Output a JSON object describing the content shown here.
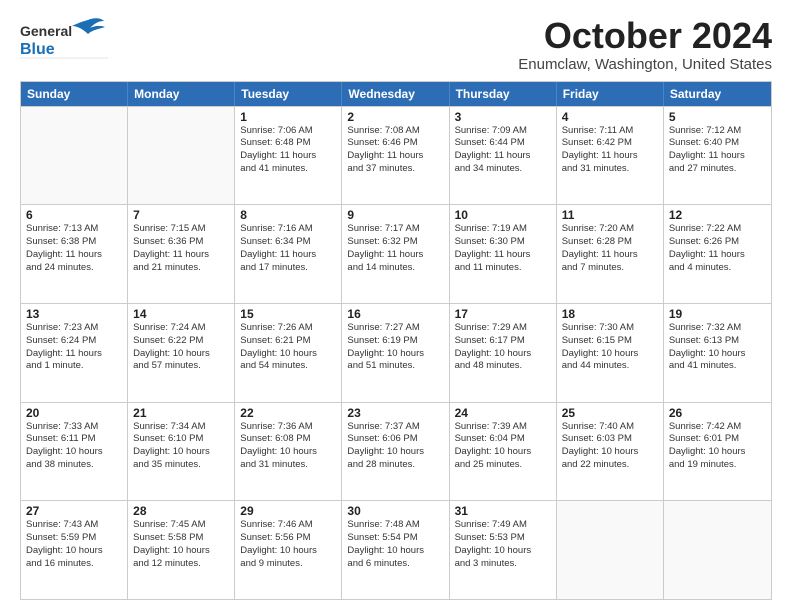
{
  "header": {
    "logo_general": "General",
    "logo_blue": "Blue",
    "title": "October 2024",
    "subtitle": "Enumclaw, Washington, United States"
  },
  "weekdays": [
    "Sunday",
    "Monday",
    "Tuesday",
    "Wednesday",
    "Thursday",
    "Friday",
    "Saturday"
  ],
  "weeks": [
    [
      {
        "day": "",
        "info": ""
      },
      {
        "day": "",
        "info": ""
      },
      {
        "day": "1",
        "info": "Sunrise: 7:06 AM\nSunset: 6:48 PM\nDaylight: 11 hours\nand 41 minutes."
      },
      {
        "day": "2",
        "info": "Sunrise: 7:08 AM\nSunset: 6:46 PM\nDaylight: 11 hours\nand 37 minutes."
      },
      {
        "day": "3",
        "info": "Sunrise: 7:09 AM\nSunset: 6:44 PM\nDaylight: 11 hours\nand 34 minutes."
      },
      {
        "day": "4",
        "info": "Sunrise: 7:11 AM\nSunset: 6:42 PM\nDaylight: 11 hours\nand 31 minutes."
      },
      {
        "day": "5",
        "info": "Sunrise: 7:12 AM\nSunset: 6:40 PM\nDaylight: 11 hours\nand 27 minutes."
      }
    ],
    [
      {
        "day": "6",
        "info": "Sunrise: 7:13 AM\nSunset: 6:38 PM\nDaylight: 11 hours\nand 24 minutes."
      },
      {
        "day": "7",
        "info": "Sunrise: 7:15 AM\nSunset: 6:36 PM\nDaylight: 11 hours\nand 21 minutes."
      },
      {
        "day": "8",
        "info": "Sunrise: 7:16 AM\nSunset: 6:34 PM\nDaylight: 11 hours\nand 17 minutes."
      },
      {
        "day": "9",
        "info": "Sunrise: 7:17 AM\nSunset: 6:32 PM\nDaylight: 11 hours\nand 14 minutes."
      },
      {
        "day": "10",
        "info": "Sunrise: 7:19 AM\nSunset: 6:30 PM\nDaylight: 11 hours\nand 11 minutes."
      },
      {
        "day": "11",
        "info": "Sunrise: 7:20 AM\nSunset: 6:28 PM\nDaylight: 11 hours\nand 7 minutes."
      },
      {
        "day": "12",
        "info": "Sunrise: 7:22 AM\nSunset: 6:26 PM\nDaylight: 11 hours\nand 4 minutes."
      }
    ],
    [
      {
        "day": "13",
        "info": "Sunrise: 7:23 AM\nSunset: 6:24 PM\nDaylight: 11 hours\nand 1 minute."
      },
      {
        "day": "14",
        "info": "Sunrise: 7:24 AM\nSunset: 6:22 PM\nDaylight: 10 hours\nand 57 minutes."
      },
      {
        "day": "15",
        "info": "Sunrise: 7:26 AM\nSunset: 6:21 PM\nDaylight: 10 hours\nand 54 minutes."
      },
      {
        "day": "16",
        "info": "Sunrise: 7:27 AM\nSunset: 6:19 PM\nDaylight: 10 hours\nand 51 minutes."
      },
      {
        "day": "17",
        "info": "Sunrise: 7:29 AM\nSunset: 6:17 PM\nDaylight: 10 hours\nand 48 minutes."
      },
      {
        "day": "18",
        "info": "Sunrise: 7:30 AM\nSunset: 6:15 PM\nDaylight: 10 hours\nand 44 minutes."
      },
      {
        "day": "19",
        "info": "Sunrise: 7:32 AM\nSunset: 6:13 PM\nDaylight: 10 hours\nand 41 minutes."
      }
    ],
    [
      {
        "day": "20",
        "info": "Sunrise: 7:33 AM\nSunset: 6:11 PM\nDaylight: 10 hours\nand 38 minutes."
      },
      {
        "day": "21",
        "info": "Sunrise: 7:34 AM\nSunset: 6:10 PM\nDaylight: 10 hours\nand 35 minutes."
      },
      {
        "day": "22",
        "info": "Sunrise: 7:36 AM\nSunset: 6:08 PM\nDaylight: 10 hours\nand 31 minutes."
      },
      {
        "day": "23",
        "info": "Sunrise: 7:37 AM\nSunset: 6:06 PM\nDaylight: 10 hours\nand 28 minutes."
      },
      {
        "day": "24",
        "info": "Sunrise: 7:39 AM\nSunset: 6:04 PM\nDaylight: 10 hours\nand 25 minutes."
      },
      {
        "day": "25",
        "info": "Sunrise: 7:40 AM\nSunset: 6:03 PM\nDaylight: 10 hours\nand 22 minutes."
      },
      {
        "day": "26",
        "info": "Sunrise: 7:42 AM\nSunset: 6:01 PM\nDaylight: 10 hours\nand 19 minutes."
      }
    ],
    [
      {
        "day": "27",
        "info": "Sunrise: 7:43 AM\nSunset: 5:59 PM\nDaylight: 10 hours\nand 16 minutes."
      },
      {
        "day": "28",
        "info": "Sunrise: 7:45 AM\nSunset: 5:58 PM\nDaylight: 10 hours\nand 12 minutes."
      },
      {
        "day": "29",
        "info": "Sunrise: 7:46 AM\nSunset: 5:56 PM\nDaylight: 10 hours\nand 9 minutes."
      },
      {
        "day": "30",
        "info": "Sunrise: 7:48 AM\nSunset: 5:54 PM\nDaylight: 10 hours\nand 6 minutes."
      },
      {
        "day": "31",
        "info": "Sunrise: 7:49 AM\nSunset: 5:53 PM\nDaylight: 10 hours\nand 3 minutes."
      },
      {
        "day": "",
        "info": ""
      },
      {
        "day": "",
        "info": ""
      }
    ]
  ]
}
